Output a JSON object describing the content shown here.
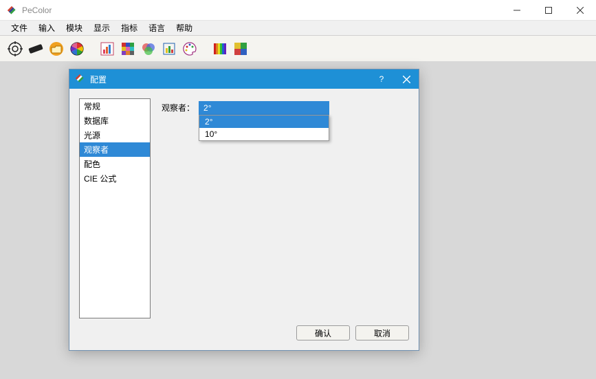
{
  "app": {
    "title": "PeColor"
  },
  "menu": {
    "items": [
      "文件",
      "输入",
      "模块",
      "显示",
      "指标",
      "语言",
      "帮助"
    ]
  },
  "dialog": {
    "title": "配置",
    "sidebar": [
      "常规",
      "数据库",
      "光源",
      "观察者",
      "配色",
      "CIE 公式"
    ],
    "selected_index": 3,
    "field_label": "观察者：",
    "combo_selected": "2°",
    "combo_options": [
      "2°",
      "10°"
    ],
    "ok": "确认",
    "cancel": "取消"
  }
}
